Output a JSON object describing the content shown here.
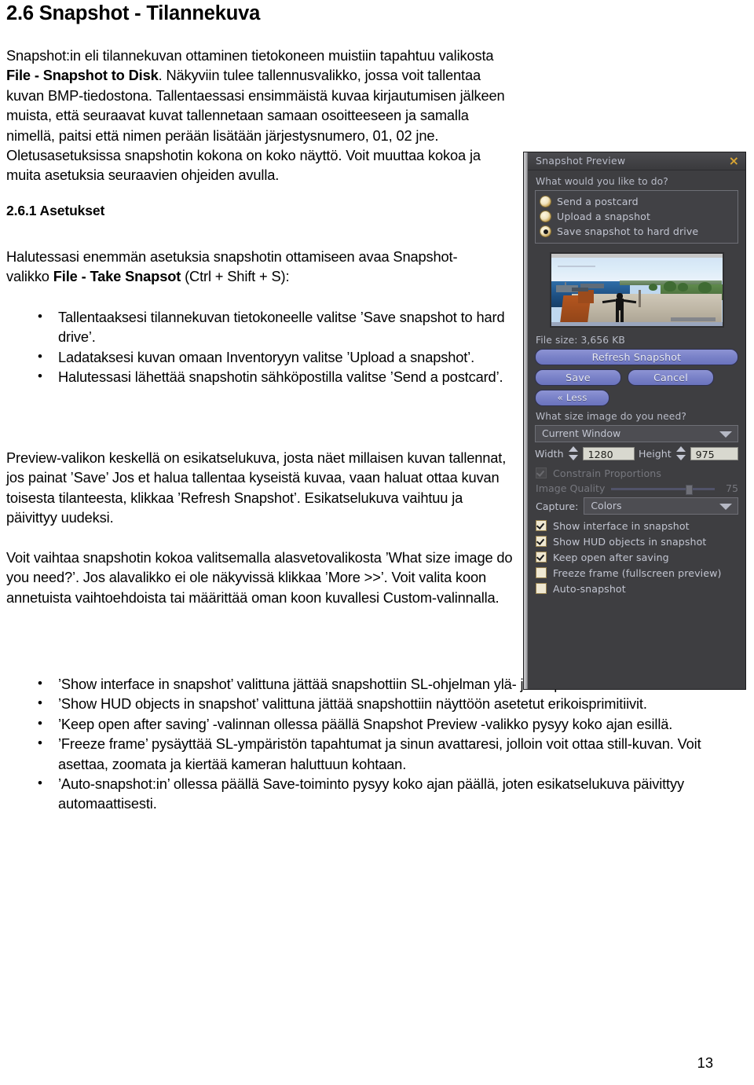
{
  "document": {
    "chapter_title": "2.6 Snapshot - Tilannekuva",
    "section_title": "2.6.1 Asetukset",
    "page_number": "13",
    "paragraph_1": {
      "part1": "Snapshot:in eli tilannekuvan ottaminen tietokoneen muistiin tapahtuu valikosta ",
      "bold1": "File - Snapshot to Disk",
      "part2": ". Näkyviin tulee tallennusvalikko, jossa voit tallentaa kuvan BMP-tiedostona. Tallentaessasi ensimmäistä kuvaa kirjautumisen jälkeen muista, että seuraavat kuvat tallennetaan samaan osoitteeseen ja samalla nimellä, paitsi että nimen perään lisätään järjestysnumero, 01, 02 jne. Oletusasetuksissa snapshotin kokona on koko näyttö. Voit muuttaa kokoa ja muita asetuksia seuraavien ohjeiden avulla."
    },
    "paragraph_2": {
      "part1": "Halutessasi enemmän asetuksia snapshotin ottamiseen avaa Snapshot-valikko ",
      "bold1": "File - Take Snapsot",
      "part2": " (Ctrl + Shift + S):"
    },
    "bullets_1": [
      "Tallentaaksesi tilannekuvan tietokoneelle valitse ’Save snapshot to hard drive’.",
      "Ladataksesi kuvan omaan Inventoryyn valitse ’Upload a snapshot’.",
      "Halutessasi lähettää snapshotin sähköpostilla valitse ’Send a postcard’."
    ],
    "paragraph_3": "Preview-valikon keskellä on esikatselukuva, josta näet millaisen kuvan tallennat, jos painat ’Save’ Jos et halua tallentaa kyseistä kuvaa, vaan haluat ottaa kuvan toisesta tilanteesta, klikkaa ’Refresh Snapshot’. Esikatselukuva vaihtuu ja päivittyy uudeksi.",
    "paragraph_4": "Voit vaihtaa snapshotin kokoa valitsemalla alasvetovalikosta ’What size image do you need?’. Jos alavalikko ei ole näkyvissä klikkaa ’More >>’. Voit valita koon annetuista vaihtoehdoista tai määrittää oman koon kuvallesi Custom-valinnalla.",
    "bullets_2": [
      "’Show interface in snapshot’ valittuna jättää snapshottiin SL-ohjelman ylä- ja alapalkit.",
      "’Show HUD objects in snapshot’ valittuna jättää snapshottiin näyttöön asetetut erikoisprimitiivit.",
      "’Keep open after saving’ -valinnan ollessa päällä Snapshot Preview -valikko pysyy koko ajan esillä.",
      "’Freeze frame’ pysäyttää SL-ympäristön tapahtumat ja sinun avattaresi, jolloin voit ottaa still-kuvan. Voit asettaa, zoomata ja kiertää kameran haluttuun kohtaan.",
      "’Auto-snapshot:in’ ollessa päällä Save-toiminto pysyy koko ajan päällä, joten esikatselukuva päivittyy automaattisesti."
    ]
  },
  "dialog": {
    "title": "Snapshot Preview",
    "close_icon": "×",
    "question": "What would you like to do?",
    "radio_options": [
      {
        "label": "Send a postcard",
        "selected": false
      },
      {
        "label": "Upload a snapshot",
        "selected": false
      },
      {
        "label": "Save snapshot to hard drive",
        "selected": true
      }
    ],
    "file_size": "File size: 3,656 KB",
    "buttons": {
      "refresh": "Refresh Snapshot",
      "save": "Save",
      "cancel": "Cancel",
      "less": "« Less"
    },
    "size_question": "What size image do you need?",
    "size_preset": "Current Window",
    "width_label": "Width",
    "width_value": "1280",
    "height_label": "Height",
    "height_value": "975",
    "constrain_label": "Constrain Proportions",
    "constrain_checked": true,
    "quality_label": "Image Quality",
    "quality_value": "75",
    "capture_label": "Capture:",
    "capture_value": "Colors",
    "checkboxes": [
      {
        "label": "Show interface in snapshot",
        "checked": true
      },
      {
        "label": "Show HUD objects in snapshot",
        "checked": true
      },
      {
        "label": "Keep open after saving",
        "checked": true
      },
      {
        "label": "Freeze frame (fullscreen preview)",
        "checked": false
      },
      {
        "label": "Auto-snapshot",
        "checked": false
      }
    ],
    "colors": {
      "panel_bg": "#3e3e41",
      "text": "#c2c5d1",
      "button": "#7b83c9",
      "accent_gold": "#d8a533",
      "field_bg": "#d8d8cf"
    }
  }
}
